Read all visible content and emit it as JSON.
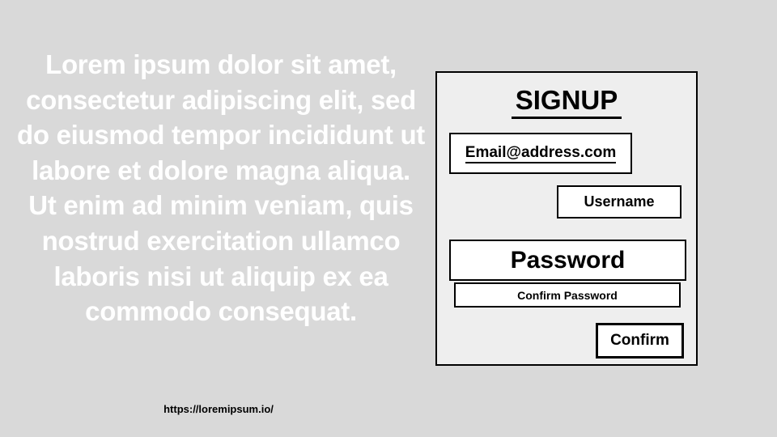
{
  "intro": {
    "text": "Lorem ipsum dolor sit amet, consectetur adipiscing elit, sed do eiusmod tempor incididunt ut labore et dolore magna aliqua. Ut enim ad minim veniam, quis nostrud exercitation ullamco laboris nisi ut aliquip ex ea commodo consequat.",
    "link": "https://loremipsum.io/"
  },
  "signup": {
    "title": "SIGNUP",
    "email": "Email@address.com",
    "username": "Username",
    "password": "Password",
    "confirm_password": "Confirm Password",
    "confirm_button": "Confirm"
  },
  "colors": {
    "background": "#d9d9d9",
    "panel": "#eeeeee",
    "intro_text": "#ffffff",
    "border": "#000000"
  }
}
